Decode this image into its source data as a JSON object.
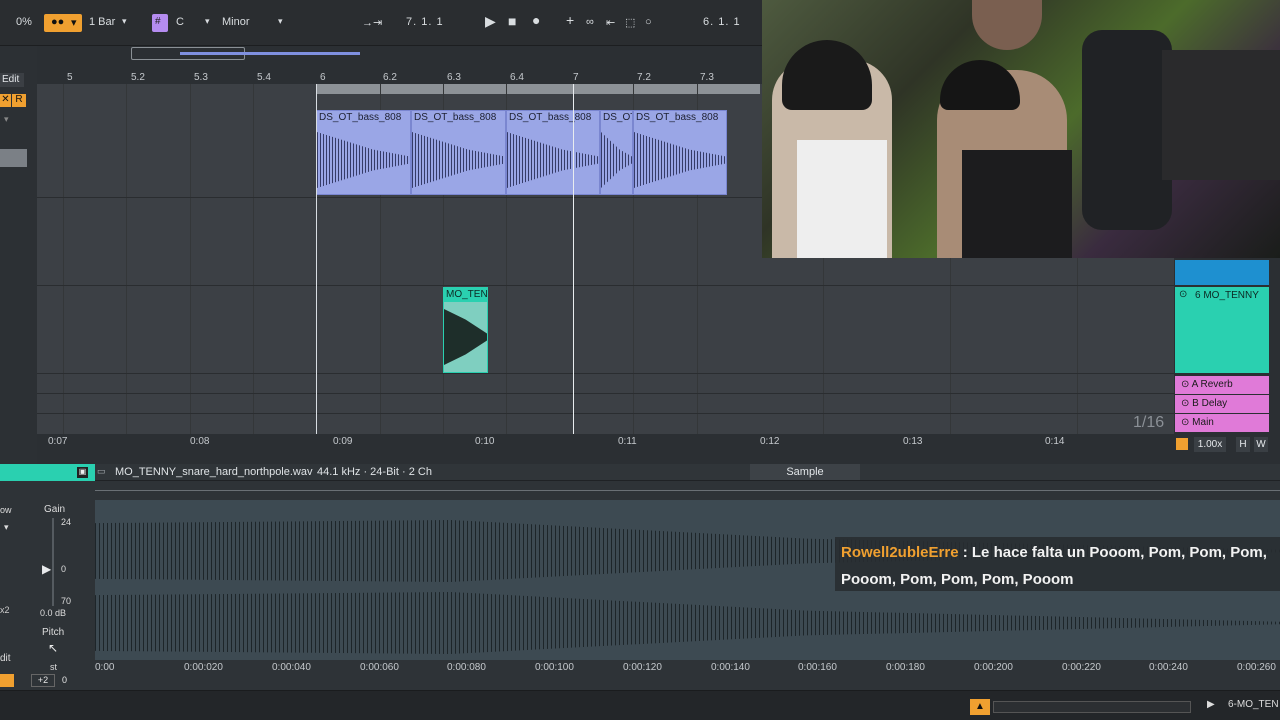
{
  "toolbar": {
    "cpu": "0%",
    "quantize": "1 Bar",
    "key": "C",
    "scale": "Minor",
    "position": "7.   1.   1",
    "loop_start": "6.   1.   1"
  },
  "arrangement": {
    "edit_label": "Edit",
    "bar_ticks": [
      "5",
      "5.2",
      "5.3",
      "5.4",
      "6",
      "6.2",
      "6.3",
      "6.4",
      "7",
      "7.2",
      "7.3"
    ],
    "clips_bass": [
      "DS_OT_bass_808",
      "DS_OT_bass_808",
      "DS_OT_bass_808",
      "DS_OT",
      "DS_OT_bass_808"
    ],
    "clip_snare": "MO_TEN",
    "time_ticks": [
      "0:07",
      "0:08",
      "0:09",
      "0:10",
      "0:11",
      "0:12",
      "0:13",
      "0:14"
    ],
    "grid_label": "1/16"
  },
  "tracks": {
    "track6": "6 MO_TENNY",
    "return_a": "A Reverb",
    "return_b": "B Delay",
    "main": "Main",
    "zoom": "1.00x",
    "h": "H",
    "w": "W"
  },
  "detail": {
    "filename": "MO_TENNY_snare_hard_northpole.wav",
    "format": "44.1 kHz · 24-Bit · 2 Ch",
    "sample_tab": "Sample",
    "gain_label": "Gain",
    "gain_max": "24",
    "gain_mid": "0",
    "gain_min": "70",
    "gain_db": "0.0 dB",
    "pitch_label": "Pitch",
    "st": "st",
    "pitch_semi": "+2",
    "pitch_cents": "0",
    "time_ticks": [
      "0:00",
      "0:00:020",
      "0:00:040",
      "0:00:060",
      "0:00:080",
      "0:00:100",
      "0:00:120",
      "0:00:140",
      "0:00:160",
      "0:00:180",
      "0:00:200",
      "0:00:220",
      "0:00:240",
      "0:00:260"
    ],
    "left_labels": [
      "ow",
      "x2",
      "dit"
    ]
  },
  "chat": {
    "user": "Rowell2ubleErre",
    "sep": " : ",
    "message": "Le hace falta un Pooom, Pom, Pom, Pom, Pooom, Pom, Pom, Pom, Pooom"
  },
  "status": {
    "track": "6-MO_TEN"
  },
  "colors": {
    "accent": "#f0a030",
    "teal": "#2ad0b0",
    "bass_clip": "#9aa6e6",
    "return": "#e07ad8",
    "track_blue": "#1e90d0"
  }
}
